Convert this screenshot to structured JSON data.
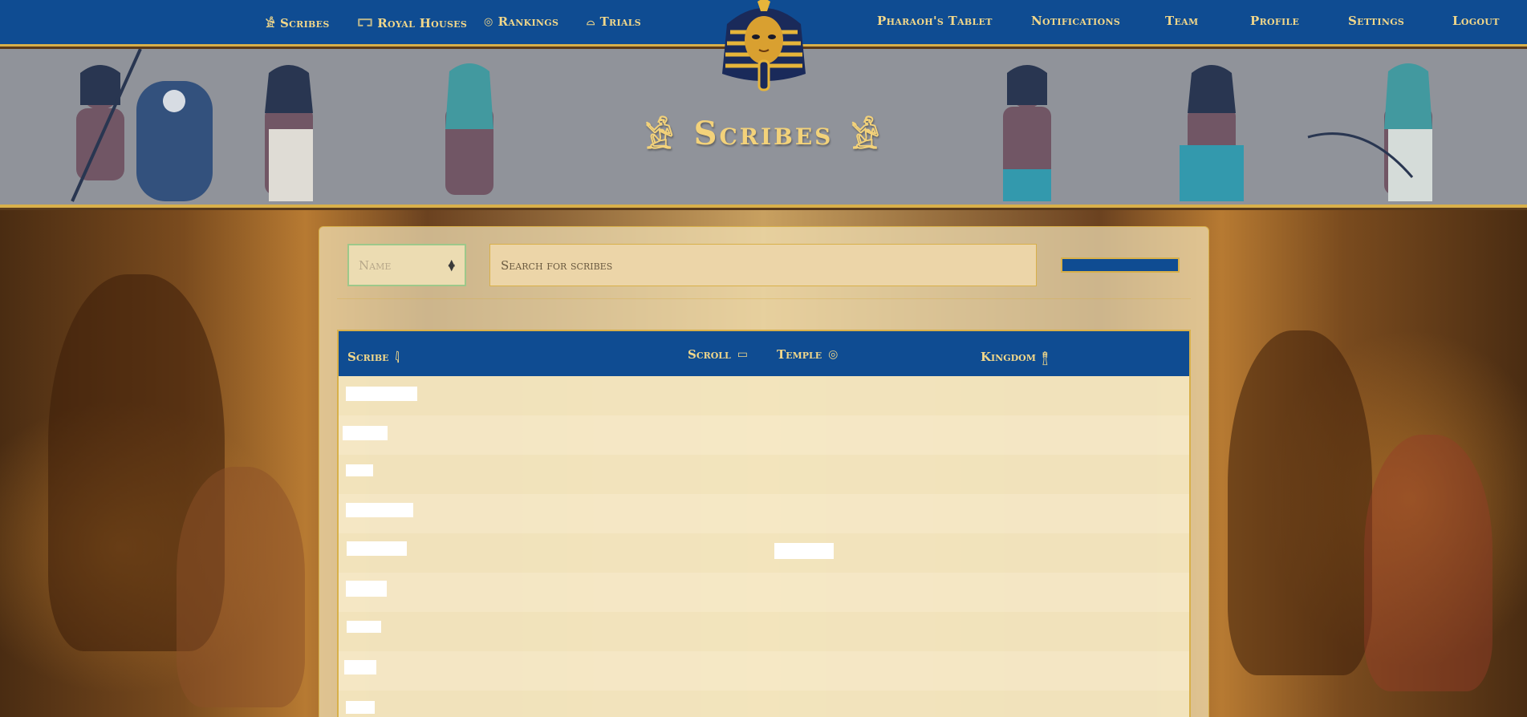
{
  "nav": {
    "left": [
      {
        "label": "Scribes",
        "icon": "scribe-icon",
        "glyph": "𓀀"
      },
      {
        "label": "Royal Houses",
        "icon": "obelisk-icon",
        "glyph": "𓉐"
      },
      {
        "label": "Rankings",
        "icon": "sun-disc-icon",
        "glyph": "◎"
      },
      {
        "label": "Trials",
        "icon": "bread-icon",
        "glyph": "⌓"
      }
    ],
    "right": [
      {
        "label": "Pharaoh's Tablet"
      },
      {
        "label": "Notifications"
      },
      {
        "label": "Team"
      },
      {
        "label": "Profile"
      },
      {
        "label": "Settings"
      },
      {
        "label": "Logout"
      }
    ]
  },
  "banner": {
    "title": "Scribes"
  },
  "controls": {
    "sort_placeholder": "Name",
    "search_placeholder": "Search for scribes"
  },
  "table": {
    "columns": [
      {
        "label": "Scribe",
        "icon": "reeds-icon",
        "glyph": "𓇋"
      },
      {
        "label": "Scroll",
        "icon": "scroll-icon",
        "glyph": "▭"
      },
      {
        "label": "Temple",
        "icon": "sun-disc-icon",
        "glyph": "◎"
      },
      {
        "label": "Kingdom",
        "icon": "pillar-icon",
        "glyph": "𓊽"
      }
    ],
    "rows": [
      {
        "scribe": "",
        "scroll": "",
        "temple": "",
        "kingdom": ""
      },
      {
        "scribe": "",
        "scroll": "",
        "temple": "",
        "kingdom": ""
      },
      {
        "scribe": "",
        "scroll": "",
        "temple": "",
        "kingdom": ""
      },
      {
        "scribe": "",
        "scroll": "",
        "temple": "",
        "kingdom": ""
      },
      {
        "scribe": "",
        "scroll": "",
        "temple": "",
        "kingdom": ""
      },
      {
        "scribe": "",
        "scroll": "",
        "temple": "",
        "kingdom": ""
      },
      {
        "scribe": "",
        "scroll": "",
        "temple": "",
        "kingdom": ""
      },
      {
        "scribe": "",
        "scroll": "",
        "temple": "",
        "kingdom": ""
      },
      {
        "scribe": "",
        "scroll": "",
        "temple": "",
        "kingdom": ""
      }
    ]
  },
  "colors": {
    "nav_bg": "#0f4c92",
    "gold": "#d8b04a",
    "gold_text": "#f1d78a",
    "panel_bg": "#f3e2b6"
  }
}
